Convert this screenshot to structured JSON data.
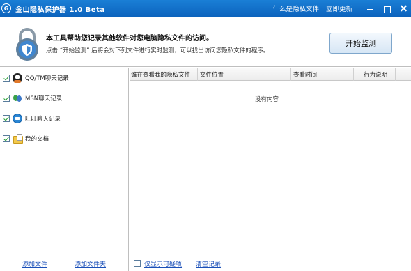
{
  "window": {
    "logo_glyph": "G",
    "title": "金山隐私保护器 1.0 Beta",
    "links": [
      "什么是隐私文件",
      "立即更新"
    ]
  },
  "header": {
    "main_text": "本工具帮助您记录其他软件对您电脑隐私文件的访问。",
    "sub_text": "点击 “开始监测” 后将会对下列文件进行实时监测，可以找出访问您隐私文件的程序。",
    "start_button": "开始监测",
    "icon": "privacy-lock-icon"
  },
  "categories": [
    {
      "label": "QQ/TM聊天记录",
      "icon": "qq-icon",
      "checked": true
    },
    {
      "label": "MSN聊天记录",
      "icon": "msn-icon",
      "checked": true
    },
    {
      "label": "旺旺聊天记录",
      "icon": "wangwang-icon",
      "checked": true
    },
    {
      "label": "我的文档",
      "icon": "documents-folder-icon",
      "checked": true
    }
  ],
  "left_footer": {
    "add_file": "添加文件",
    "add_folder": "添加文件夹"
  },
  "table": {
    "columns": [
      "谁在查看我的隐私文件",
      "文件位置",
      "查看时间",
      "行为说明"
    ],
    "empty_message": "没有内容"
  },
  "right_footer": {
    "only_suspicious": "仅显示可疑项",
    "only_suspicious_checked": false,
    "clear_records": "清空记录"
  },
  "colors": {
    "titlebar": "#0c63bd",
    "link": "#1a4fb8",
    "check": "#1a9a2a"
  }
}
